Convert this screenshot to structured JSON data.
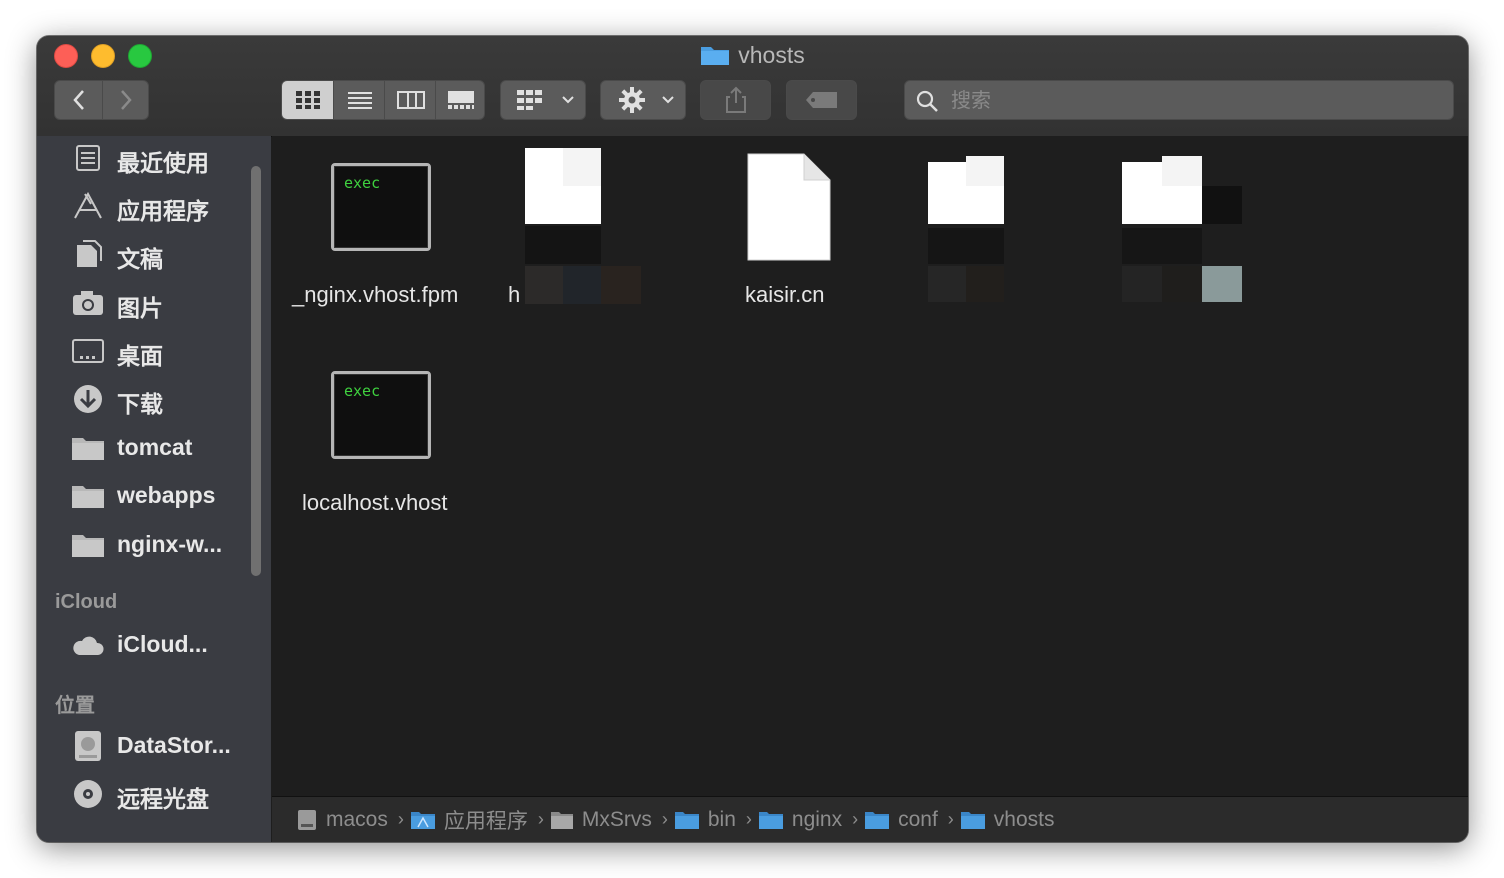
{
  "window": {
    "title": "vhosts"
  },
  "search": {
    "placeholder": "搜索"
  },
  "sidebar": {
    "favorites": [
      {
        "label": "最近使用",
        "icon": "recents-icon"
      },
      {
        "label": "应用程序",
        "icon": "applications-icon"
      },
      {
        "label": "文稿",
        "icon": "documents-icon"
      },
      {
        "label": "图片",
        "icon": "pictures-icon"
      },
      {
        "label": "桌面",
        "icon": "desktop-icon"
      },
      {
        "label": "下载",
        "icon": "downloads-icon"
      },
      {
        "label": "tomcat",
        "icon": "folder-icon"
      },
      {
        "label": "webapps",
        "icon": "folder-icon"
      },
      {
        "label": "nginx-w...",
        "icon": "folder-icon"
      }
    ],
    "icloud_header": "iCloud",
    "icloud": [
      {
        "label": "iCloud...",
        "icon": "cloud-icon"
      }
    ],
    "locations_header": "位置",
    "locations": [
      {
        "label": "DataStor...",
        "icon": "disk-icon"
      },
      {
        "label": "远程光盘",
        "icon": "optical-disc-icon"
      }
    ]
  },
  "files": [
    {
      "name": "_nginx.vhost.fpm",
      "kind": "exec",
      "exec_text": "exec"
    },
    {
      "name": "h",
      "kind": "blurred"
    },
    {
      "name": "kaisir.cn",
      "kind": "document"
    },
    {
      "name": "",
      "kind": "blurred"
    },
    {
      "name": "",
      "kind": "blurred"
    },
    {
      "name": "localhost.vhost",
      "kind": "exec",
      "exec_text": "exec"
    }
  ],
  "pathbar": [
    {
      "label": "macos",
      "icon": "hard-drive-icon"
    },
    {
      "label": "应用程序",
      "icon": "applications-folder-icon"
    },
    {
      "label": "MxSrvs",
      "icon": "folder-icon"
    },
    {
      "label": "bin",
      "icon": "folder-icon"
    },
    {
      "label": "nginx",
      "icon": "folder-icon"
    },
    {
      "label": "conf",
      "icon": "folder-icon"
    },
    {
      "label": "vhosts",
      "icon": "folder-icon"
    }
  ],
  "colors": {
    "folder_blue": "#4a9de0",
    "exec_green": "#3fd13f",
    "sidebar_bg": "#3a3c42",
    "content_bg": "#1e1e1e"
  }
}
